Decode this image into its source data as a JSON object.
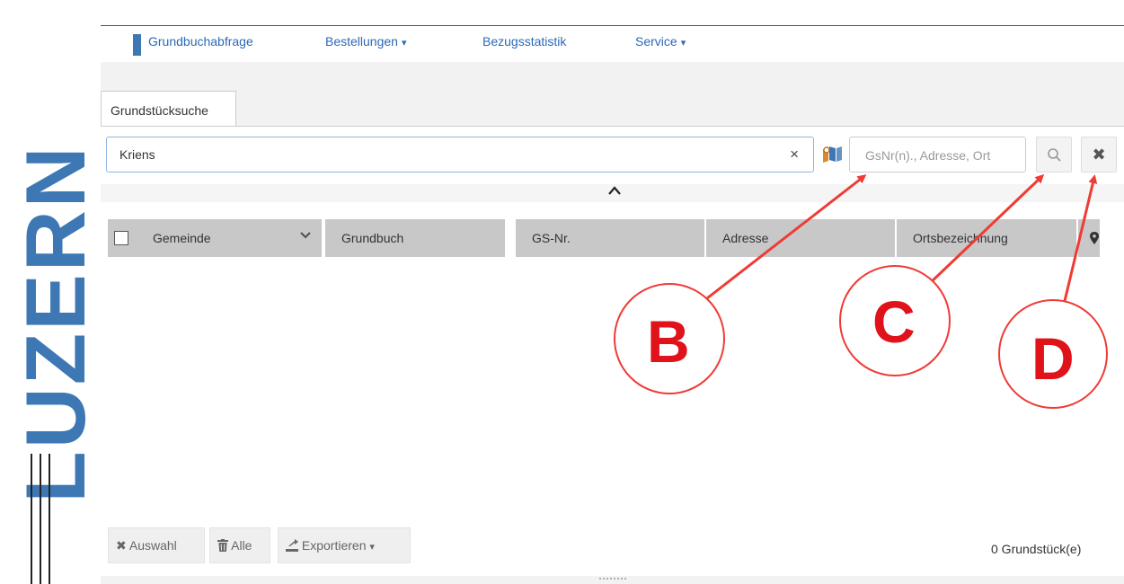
{
  "logo": {
    "text": "LUZERN",
    "color": "#3d78b5"
  },
  "nav": {
    "items": [
      {
        "label": "Grundbuchabfrage"
      },
      {
        "label": "Bestellungen",
        "caret": "▾"
      },
      {
        "label": "Bezugsstatistik"
      },
      {
        "label": "Service",
        "caret": "▾"
      }
    ]
  },
  "tab": {
    "label": "Grundstücksuche"
  },
  "search": {
    "value": "Kriens",
    "clear": "×",
    "gs_placeholder": "GsNr(n)., Adresse, Ort",
    "search_icon": "search-icon",
    "reset_icon": "close-icon",
    "reset_glyph": "✖"
  },
  "table": {
    "columns": [
      "Gemeinde",
      "Grundbuch",
      "GS-Nr.",
      "Adresse",
      "Ortsbezeichnung"
    ],
    "rows": []
  },
  "footer": {
    "buttons": [
      {
        "label": "Auswahl",
        "icon": "close-icon"
      },
      {
        "label": "Alle",
        "icon": "trash-icon"
      },
      {
        "label": "Exportieren",
        "icon": "export-icon",
        "caret": "▾"
      }
    ],
    "count": "0 Grundstück(e)"
  },
  "annotations": {
    "color": "#e0121a",
    "labels": [
      "B",
      "C",
      "D"
    ]
  }
}
